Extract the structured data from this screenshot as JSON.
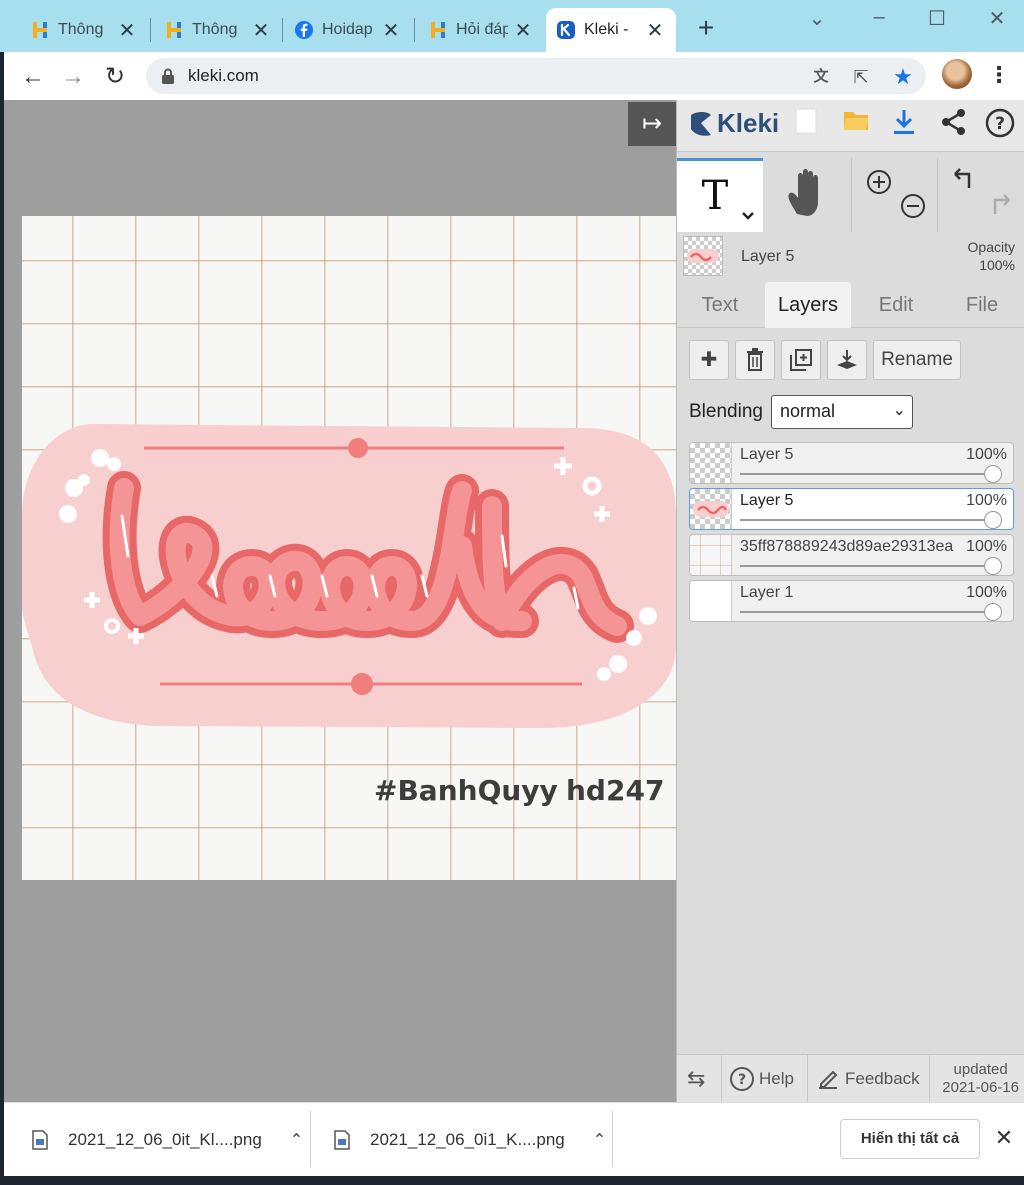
{
  "browser": {
    "tabs": [
      {
        "label": "Thông",
        "icon": "hoidap-h-icon",
        "active": false
      },
      {
        "label": "Thông",
        "icon": "hoidap-h-icon",
        "active": false
      },
      {
        "label": "Hoidap",
        "icon": "facebook-icon",
        "active": false
      },
      {
        "label": "Hỏi đáp",
        "icon": "hoidap-h-icon",
        "active": false
      },
      {
        "label": "Kleki -",
        "icon": "kleki-icon",
        "active": true
      }
    ],
    "url": "kleki.com"
  },
  "artwork": {
    "tag1": "#BanhQuyy",
    "tag2": "hd247"
  },
  "panel": {
    "logo_text": "Kleki",
    "current_layer": "Layer 5",
    "opacity_label": "Opacity",
    "opacity_value": "100%",
    "tabs": [
      "Text",
      "Layers",
      "Edit",
      "File"
    ],
    "active_tab": "Layers",
    "rename_label": "Rename",
    "blending_label": "Blending",
    "blending_value": "normal",
    "layers": [
      {
        "name": "Layer 5",
        "opacity": "100%",
        "selected": false,
        "thumb": "checker"
      },
      {
        "name": "Layer 5",
        "opacity": "100%",
        "selected": true,
        "thumb": "art"
      },
      {
        "name": "35ff878889243d89ae29313ea",
        "opacity": "100%",
        "selected": false,
        "thumb": "grid"
      },
      {
        "name": "Layer 1",
        "opacity": "100%",
        "selected": false,
        "thumb": "white"
      }
    ],
    "footer": {
      "help": "Help",
      "feedback": "Feedback",
      "updated_label": "updated",
      "updated_date": "2021-06-16"
    }
  },
  "downloads": {
    "items": [
      "2021_12_06_0it_Kl....png",
      "2021_12_06_0i1_K....png"
    ],
    "show_all": "Hiển thị tất cả"
  },
  "colors": {
    "tabstrip": "#a8dfef",
    "accent_blue": "#1a73e8",
    "kleki_navy": "#2e4f7a",
    "sticker_pink": "#f8cfcf",
    "lettering_coral": "#f17a7a"
  }
}
